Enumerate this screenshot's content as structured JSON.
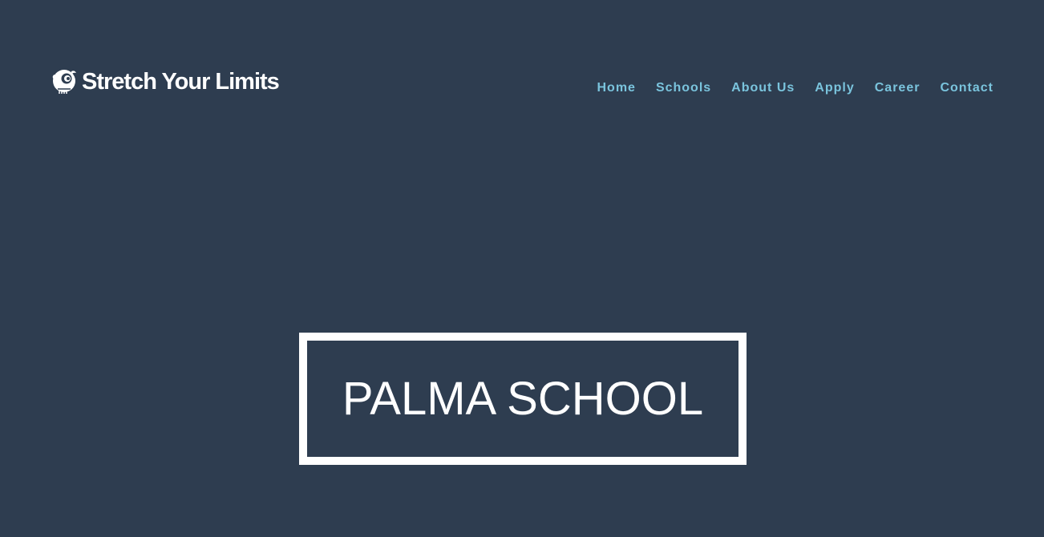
{
  "brand": {
    "logo_icon": "bird-icon",
    "title": "Stretch Your Limits"
  },
  "nav": {
    "items": [
      {
        "label": "Home"
      },
      {
        "label": "Schools"
      },
      {
        "label": "About Us"
      },
      {
        "label": "Apply"
      },
      {
        "label": "Career"
      },
      {
        "label": "Contact"
      }
    ]
  },
  "hero": {
    "title": "PALMA SCHOOL"
  },
  "colors": {
    "background": "#2e3d50",
    "nav_link": "#7ac4dd",
    "text": "#ffffff"
  }
}
